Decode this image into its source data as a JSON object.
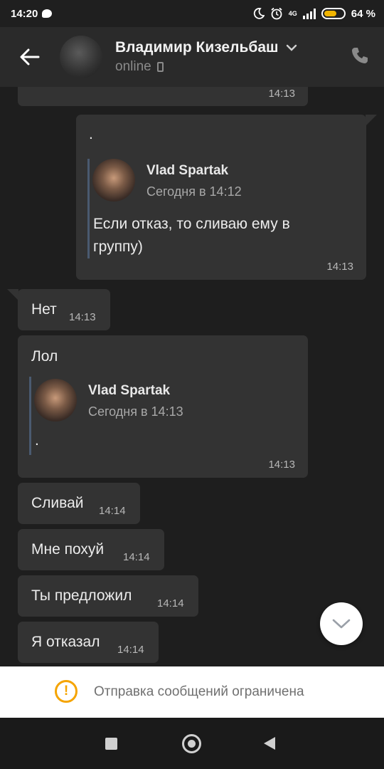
{
  "status_bar": {
    "time": "14:20",
    "network": "4G",
    "battery_text": "64 %",
    "battery_level": 0.64
  },
  "header": {
    "contact_name": "Владимир Кизельбаш",
    "presence": "online"
  },
  "messages": [
    {
      "id": "m0",
      "direction": "in",
      "text": "",
      "time": "14:13"
    },
    {
      "id": "m1",
      "direction": "out",
      "text": ".",
      "time": "14:13",
      "quote": {
        "author": "Vlad Spartak",
        "date": "Сегодня в 14:12",
        "text": "Если отказ, то сливаю ему в группу)"
      }
    },
    {
      "id": "m2",
      "direction": "in",
      "text": "Нет",
      "time": "14:13"
    },
    {
      "id": "m3",
      "direction": "in",
      "text": "Лол",
      "time": "14:13",
      "quote": {
        "author": "Vlad Spartak",
        "date": "Сегодня в 14:13",
        "text": "."
      }
    },
    {
      "id": "m4",
      "direction": "in",
      "text": "Сливай",
      "time": "14:14"
    },
    {
      "id": "m5",
      "direction": "in",
      "text": "Мне похуй",
      "time": "14:14"
    },
    {
      "id": "m6",
      "direction": "in",
      "text": "Ты предложил",
      "time": "14:14"
    },
    {
      "id": "m7",
      "direction": "in",
      "text": "Я отказал",
      "time": "14:14"
    }
  ],
  "restriction": {
    "text": "Отправка сообщений ограничена"
  },
  "icons": {
    "back": "arrow-left-icon",
    "dropdown": "chevron-down-icon",
    "call": "phone-icon",
    "scroll": "chevron-down-icon",
    "warning": "warning-icon"
  },
  "colors": {
    "background": "#1e1e1e",
    "bubble": "#333333",
    "header": "#2a2a2a",
    "warning": "#f5a400"
  }
}
